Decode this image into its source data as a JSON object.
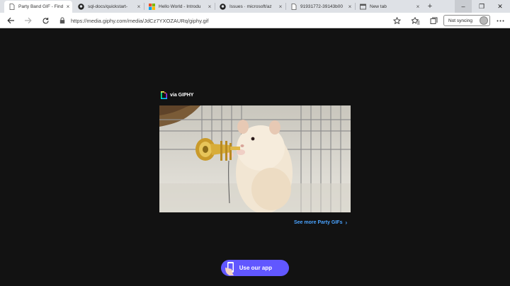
{
  "tabs": [
    {
      "title": "Party Band GIF - Find",
      "icon": "document-icon",
      "active": true
    },
    {
      "title": "sql-docs/quickstart-",
      "icon": "github-icon",
      "active": false
    },
    {
      "title": "Hello World - Introdu",
      "icon": "microsoft-icon",
      "active": false
    },
    {
      "title": "Issues · microsoft/az",
      "icon": "github-icon",
      "active": false
    },
    {
      "title": "91931772-39143b00",
      "icon": "document-icon",
      "active": false
    },
    {
      "title": "New tab",
      "icon": "newtab-icon",
      "active": false
    }
  ],
  "tab_close_glyph": "×",
  "new_tab_glyph": "+",
  "window_controls": {
    "minimize": "–",
    "maximize": "❐",
    "close": "✕"
  },
  "address_bar": {
    "url": "https://media.giphy.com/media/JdCz7YXOZAURq/giphy.gif"
  },
  "profile": {
    "sync_label": "Not syncing"
  },
  "page": {
    "via_label": "via GIPHY",
    "see_more_label": "See more Party GIFs",
    "see_more_chevron": "›",
    "app_button_label": "Use our app"
  },
  "colors": {
    "page_background": "#121212",
    "link": "#4aa3ff",
    "app_button": "#6157ff",
    "tabstrip": "#dee1e6"
  }
}
